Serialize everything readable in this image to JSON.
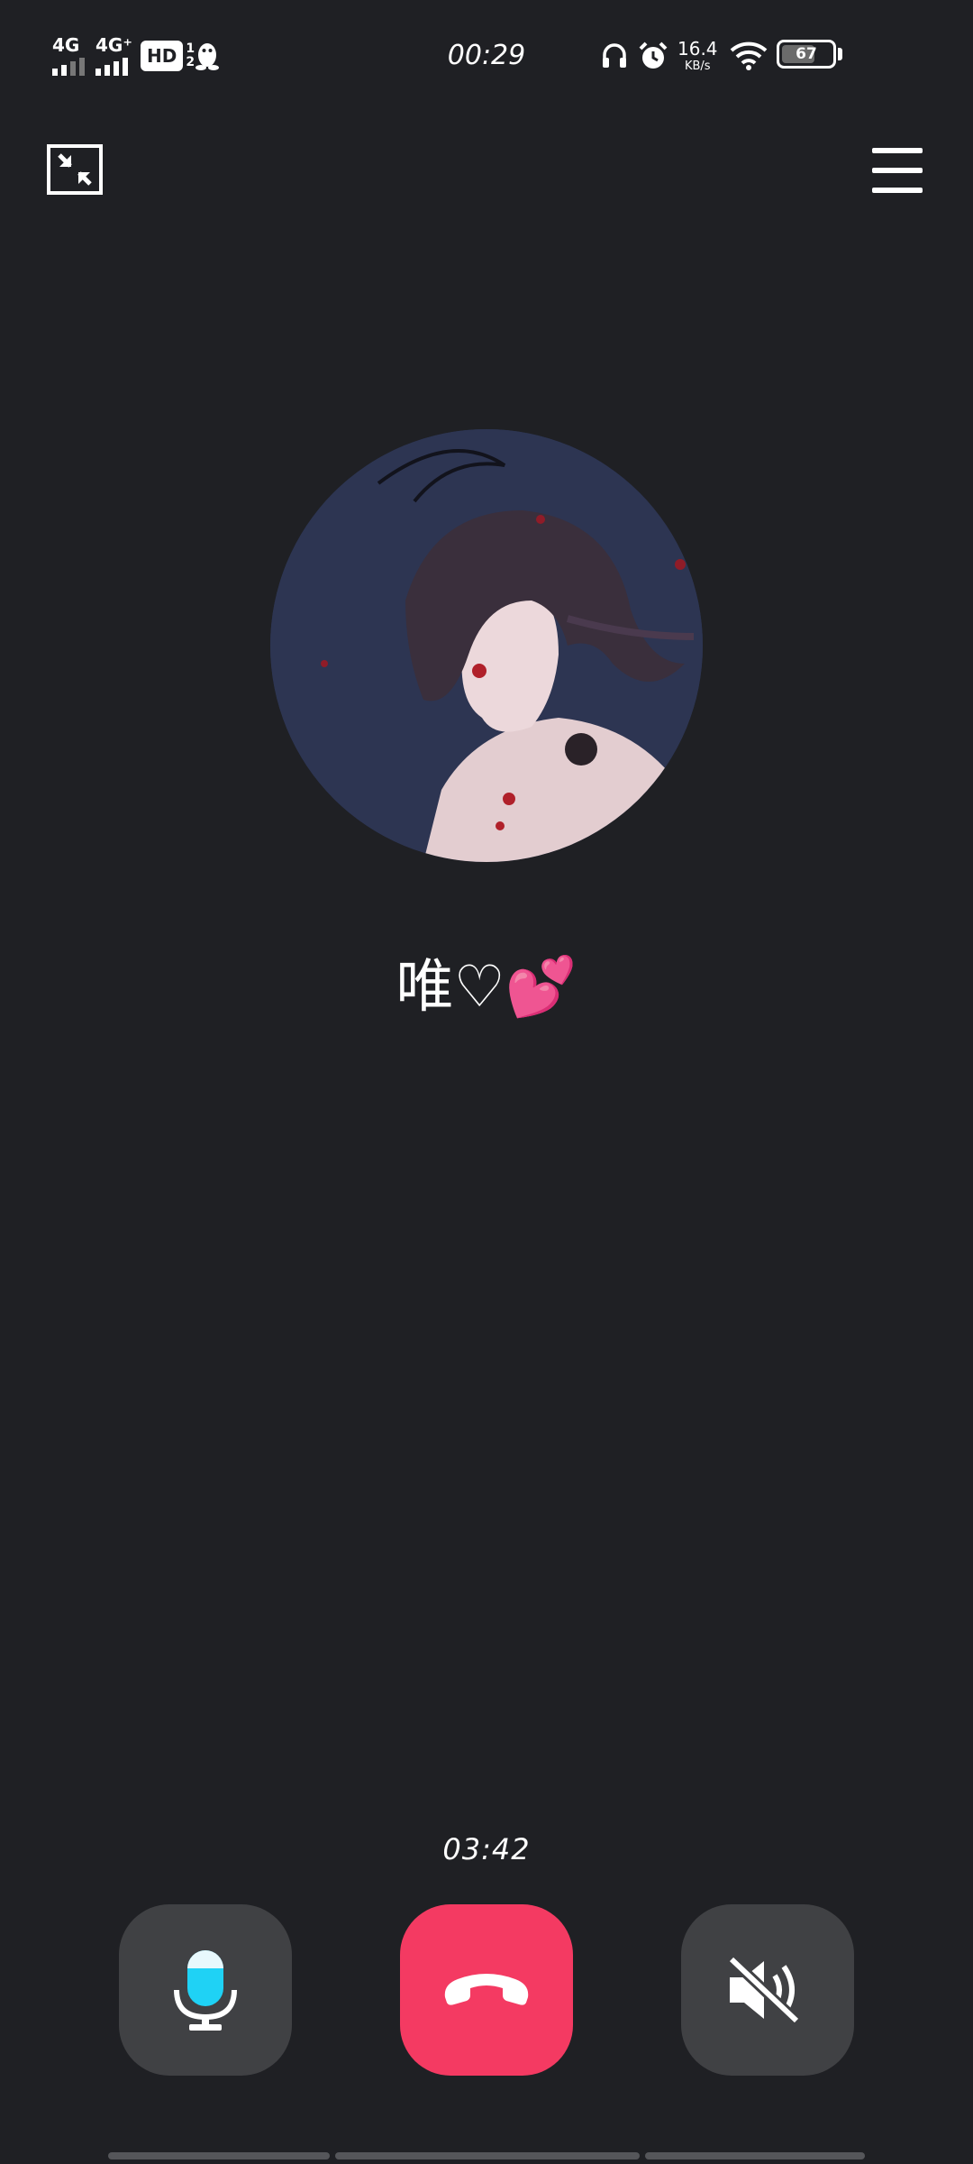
{
  "status_bar": {
    "signal1_label": "4G",
    "signal2_label": "4G⁺",
    "hd_label": "HD",
    "hd_sub_top": "1",
    "hd_sub_bottom": "2",
    "time": "00:29",
    "net_speed_value": "16.4",
    "net_speed_unit": "KB/s",
    "battery_level": "67",
    "icons": [
      "qq-penguin-icon",
      "headphones-icon",
      "alarm-icon",
      "wifi-icon",
      "battery-icon"
    ]
  },
  "top_bar": {
    "minimize_icon": "minimize-icon",
    "menu_icon": "hamburger-menu-icon"
  },
  "contact": {
    "avatar": "avatar-image",
    "name": "唯♡💕"
  },
  "call": {
    "timer": "03:42"
  },
  "controls": {
    "mic_icon": "microphone-icon",
    "hangup_icon": "hang-up-phone-icon",
    "speaker_icon": "speaker-muted-icon",
    "hangup_color": "#f43a62",
    "mic_accent": "#1fd2f5"
  }
}
